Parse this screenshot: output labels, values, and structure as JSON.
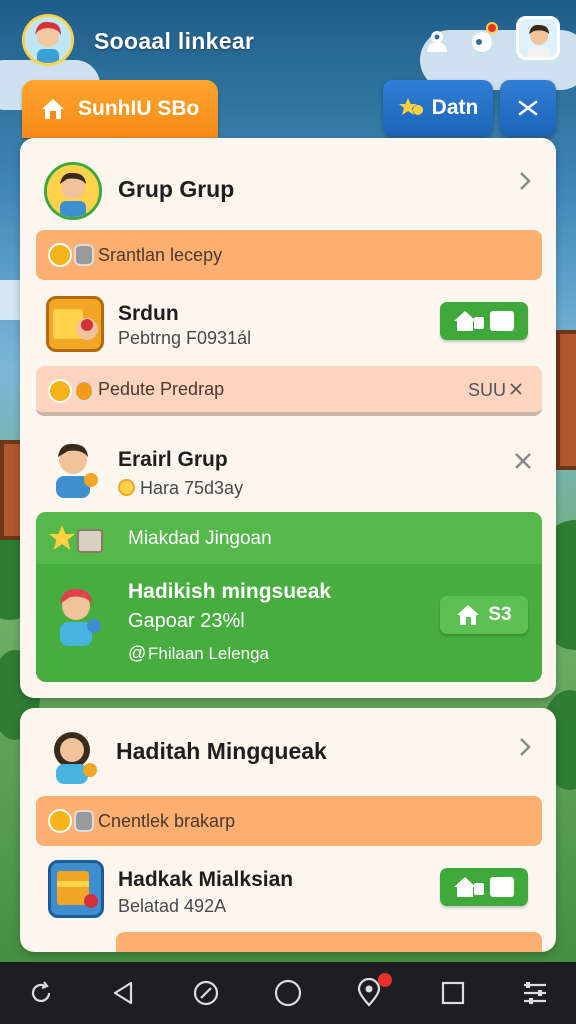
{
  "header": {
    "app_title": "Sooaal linkear"
  },
  "tabs": {
    "home_label": "SunhIU SBo",
    "data_label": "Datn"
  },
  "panel1": {
    "title": "Grup Grup",
    "strip1": "Srantlan lecepy",
    "item1": {
      "name": "Srdun",
      "sub": "Pebtrng F0931ál",
      "btn": ""
    },
    "strip2": "Pedute Predrap",
    "strip2_right": "SUU"
  },
  "panel1_group2": {
    "title": "Erairl Grup",
    "sub": "Hara 75d3ay",
    "green_head": "Miakdad Jingoan",
    "green_name": "Hadikish mingsueak",
    "green_sub": "Gapoar 23%l",
    "green_footer": "Fhilaan Lelenga",
    "green_btn": "S3"
  },
  "panel2": {
    "title": "Haditah Mingqueak",
    "strip1": "Cnentlek brakarp",
    "item1": {
      "name": "Hadkak Mialksian",
      "sub": "Belatad 492A"
    }
  },
  "colors": {
    "orange": "#f68a16",
    "blue": "#1d64b8",
    "green": "#3fa83a"
  }
}
